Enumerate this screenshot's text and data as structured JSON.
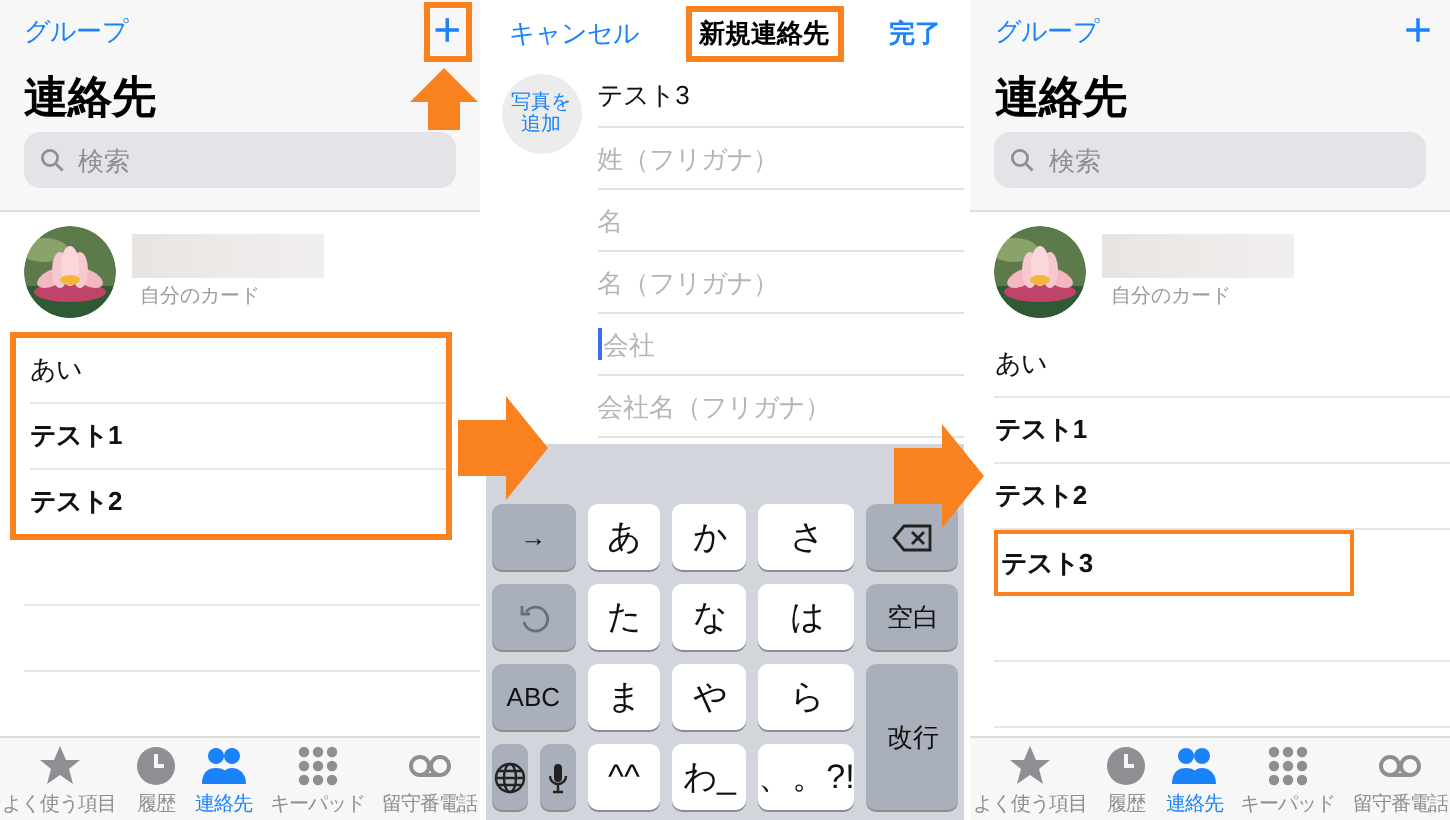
{
  "panels": [
    {
      "kind": "contacts",
      "nav": {
        "left": "グループ",
        "add": {
          "label": "+",
          "highlighted": true
        }
      },
      "title": "連絡先",
      "search": {
        "placeholder": "検索"
      },
      "my_card": {
        "caption": "自分のカード"
      },
      "list_highlighted": true,
      "contacts": [
        {
          "name": "あい",
          "bold": false,
          "highlighted": false
        },
        {
          "name": "テスト1",
          "bold": true,
          "highlighted": false
        },
        {
          "name": "テスト2",
          "bold": true,
          "highlighted": false
        }
      ],
      "tabs": [
        {
          "label": "よく使う項目",
          "selected": false
        },
        {
          "label": "履歴",
          "selected": false
        },
        {
          "label": "連絡先",
          "selected": true
        },
        {
          "label": "キーパッド",
          "selected": false
        },
        {
          "label": "留守番電話",
          "selected": false
        }
      ]
    },
    {
      "kind": "new_contact",
      "nav": {
        "cancel": "キャンセル",
        "title": "新規連絡先",
        "title_highlighted": true,
        "done": "完了"
      },
      "photo_button": "写真を追加",
      "fields": [
        {
          "value": "テスト3",
          "focused": false
        },
        {
          "placeholder": "姓（フリガナ）",
          "focused": false
        },
        {
          "placeholder": "名",
          "focused": false
        },
        {
          "placeholder": "名（フリガナ）",
          "focused": false
        },
        {
          "placeholder": "会社",
          "focused": true
        },
        {
          "placeholder": "会社名（フリガナ）",
          "focused": false
        }
      ],
      "keyboard": [
        {
          "kind": "fn-left",
          "label": "→"
        },
        {
          "kind": "char",
          "label": "あ"
        },
        {
          "kind": "char",
          "label": "か"
        },
        {
          "kind": "char",
          "label": "さ"
        },
        {
          "kind": "backspace"
        },
        {
          "kind": "undo"
        },
        {
          "kind": "char",
          "label": "た"
        },
        {
          "kind": "char",
          "label": "な"
        },
        {
          "kind": "char",
          "label": "は"
        },
        {
          "kind": "fn-right",
          "label": "空白"
        },
        {
          "kind": "fn-left",
          "label": "ABC"
        },
        {
          "kind": "char",
          "label": "ま"
        },
        {
          "kind": "char",
          "label": "や"
        },
        {
          "kind": "char",
          "label": "ら"
        },
        {
          "kind": "return",
          "label": "改行"
        },
        {
          "kind": "globe"
        },
        {
          "kind": "mic"
        },
        {
          "kind": "char",
          "label": "^^"
        },
        {
          "kind": "char",
          "label": "わ_"
        },
        {
          "kind": "char",
          "label": "、。?!"
        }
      ]
    },
    {
      "kind": "contacts",
      "nav": {
        "left": "グループ",
        "add": {
          "label": "+",
          "highlighted": false
        }
      },
      "title": "連絡先",
      "search": {
        "placeholder": "検索"
      },
      "my_card": {
        "caption": "自分のカード"
      },
      "list_highlighted": false,
      "contacts": [
        {
          "name": "あい",
          "bold": false,
          "highlighted": false
        },
        {
          "name": "テスト1",
          "bold": true,
          "highlighted": false
        },
        {
          "name": "テスト2",
          "bold": true,
          "highlighted": false
        },
        {
          "name": "テスト3",
          "bold": true,
          "highlighted": true
        }
      ],
      "tabs": [
        {
          "label": "よく使う項目",
          "selected": false
        },
        {
          "label": "履歴",
          "selected": false
        },
        {
          "label": "連絡先",
          "selected": true
        },
        {
          "label": "キーパッド",
          "selected": false
        },
        {
          "label": "留守番電話",
          "selected": false
        }
      ]
    }
  ],
  "arrows": [
    {
      "kind": "up"
    },
    {
      "kind": "right"
    },
    {
      "kind": "right"
    }
  ]
}
